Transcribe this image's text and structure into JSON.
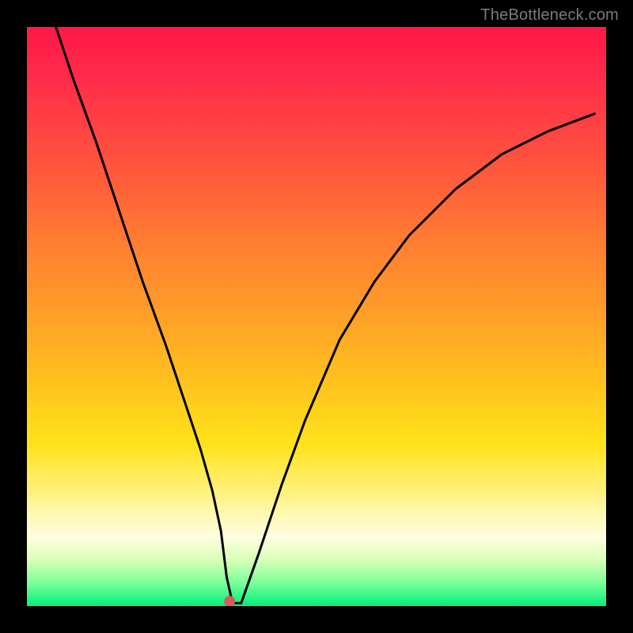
{
  "watermark": "TheBottleneck.com",
  "chart_data": {
    "type": "line",
    "title": "",
    "xlabel": "",
    "ylabel": "",
    "xlim": [
      0,
      100
    ],
    "ylim": [
      0,
      100
    ],
    "series": [
      {
        "name": "curve",
        "x": [
          5,
          8,
          12,
          16,
          20,
          24,
          28,
          30,
          32,
          33.5,
          34.5,
          35.5,
          37,
          40,
          44,
          48,
          54,
          60,
          66,
          74,
          82,
          90,
          98
        ],
        "y": [
          100,
          91,
          80,
          68,
          56,
          45,
          33,
          27,
          20,
          13,
          5,
          0.5,
          0.5,
          9,
          21,
          32,
          46,
          56,
          64,
          72,
          78,
          82,
          85
        ]
      }
    ],
    "marker": {
      "x": 35,
      "y": 0.8,
      "color": "#d85a5a",
      "radius_px": 7
    },
    "gradient_stops": [
      {
        "pct": 0,
        "color": "#ff1846"
      },
      {
        "pct": 50,
        "color": "#ffa028"
      },
      {
        "pct": 80,
        "color": "#fff07a"
      },
      {
        "pct": 100,
        "color": "#00f07a"
      }
    ]
  }
}
